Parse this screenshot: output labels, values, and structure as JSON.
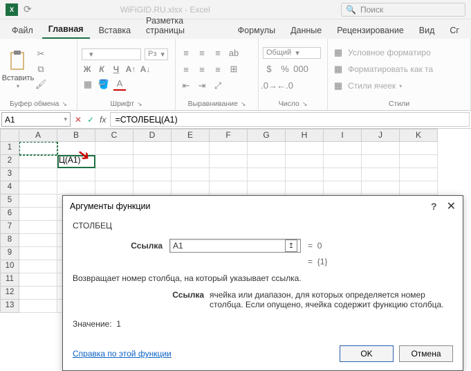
{
  "title_bar": {
    "doc_title": "WiFiGID.RU.xlsx - Excel",
    "search_placeholder": "Поиск"
  },
  "tabs": {
    "items": [
      "Файл",
      "Главная",
      "Вставка",
      "Разметка страницы",
      "Формулы",
      "Данные",
      "Рецензирование",
      "Вид",
      "Сг"
    ],
    "active_index": 1
  },
  "ribbon": {
    "clipboard": {
      "paste": "Вставить",
      "label": "Буфер обмена"
    },
    "font": {
      "label": "Шрифт",
      "bold": "Ж",
      "italic": "К",
      "underline": "Ч",
      "size": "Рз"
    },
    "alignment": {
      "label": "Выравнивание"
    },
    "number": {
      "label": "Число",
      "format": "Общий"
    },
    "styles": {
      "label": "Стили",
      "cond": "Условное форматиро",
      "table": "Форматировать как та",
      "cell": "Стили ячеек"
    }
  },
  "formula_bar": {
    "namebox": "A1",
    "formula": "=СТОЛБЕЦ(A1)"
  },
  "grid": {
    "columns": [
      "A",
      "B",
      "C",
      "D",
      "E",
      "F",
      "G",
      "H",
      "I",
      "J",
      "K"
    ],
    "rows": [
      "1",
      "2",
      "3",
      "4",
      "5",
      "6",
      "7",
      "8",
      "9",
      "10",
      "11",
      "12",
      "13"
    ],
    "b2_display": "Ц(A1)"
  },
  "dialog": {
    "title": "Аргументы функции",
    "func_name": "СТОЛБЕЦ",
    "arg_label": "Ссылка",
    "arg_value": "A1",
    "arg_result_prefix": "=",
    "arg_result": "0",
    "overall_result_prefix": "=",
    "overall_result": "{1}",
    "description": "Возвращает номер столбца, на который указывает ссылка.",
    "arg_name": "Ссылка",
    "arg_desc": "ячейка или диапазон, для которых определяется номер столбца. Если опущено, ячейка содержит функцию столбца.",
    "value_label": "Значение:",
    "value": "1",
    "help_link": "Справка по этой функции",
    "ok": "OK",
    "cancel": "Отмена"
  }
}
